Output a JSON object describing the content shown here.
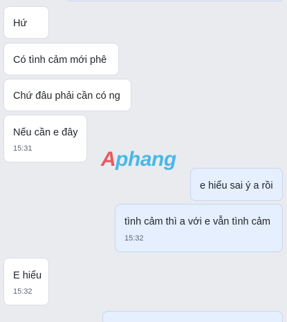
{
  "messages": [
    {
      "direction": "incoming",
      "text": "Hứ",
      "time": ""
    },
    {
      "direction": "incoming",
      "text": "Có tình cảm mới phê",
      "time": ""
    },
    {
      "direction": "incoming",
      "text": "Chứ đâu phải cần có ng",
      "time": ""
    },
    {
      "direction": "incoming",
      "text": "Nếu cần e đây",
      "time": "15:31"
    },
    {
      "direction": "outgoing",
      "text": "e hiểu sai ý a rồi",
      "time": ""
    },
    {
      "direction": "outgoing",
      "text": "tình cảm thì a với e vẫn tình cảm",
      "time": "15:32"
    },
    {
      "direction": "incoming",
      "text": "E hiểu",
      "time": "15:32"
    }
  ],
  "watermark": {
    "first": "A",
    "rest": "phang"
  },
  "colors": {
    "background": "#e9ebef",
    "incoming_bubble": "#ffffff",
    "outgoing_bubble": "#e5effd"
  }
}
